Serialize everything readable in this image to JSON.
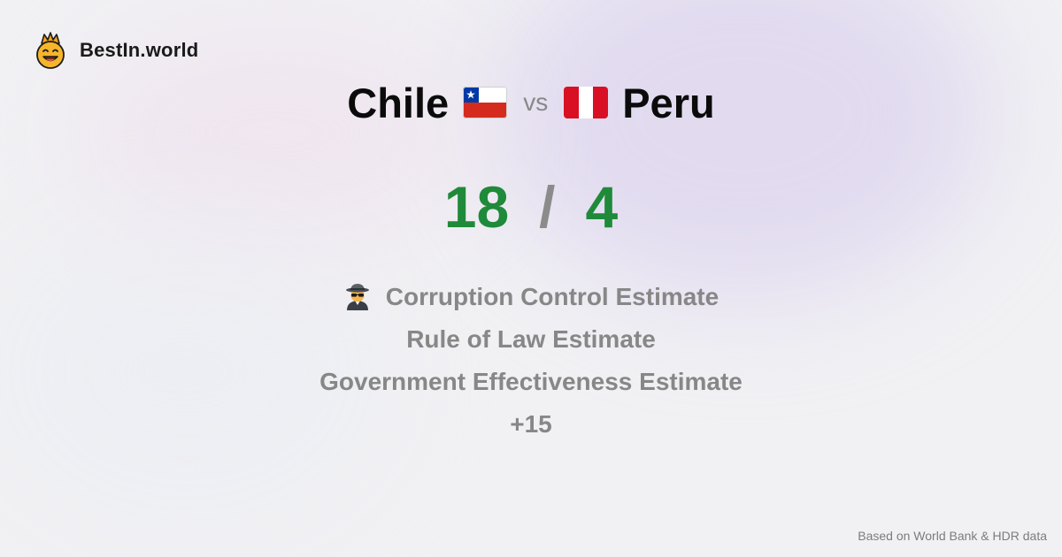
{
  "brand": {
    "name": "BestIn.world",
    "logo_icon": "crowned-smiley-icon"
  },
  "comparison": {
    "left_country": "Chile",
    "left_flag_icon": "chile-flag-icon",
    "separator": "vs",
    "right_country": "Peru",
    "right_flag_icon": "peru-flag-icon"
  },
  "score": {
    "left": "18",
    "divider": "/",
    "right": "4"
  },
  "metrics": [
    {
      "label": "Corruption Control Estimate",
      "icon": "spy-detective-icon"
    },
    {
      "label": "Rule of Law Estimate"
    },
    {
      "label": "Government Effectiveness Estimate"
    },
    {
      "label": "+15"
    }
  ],
  "footer": {
    "source_note": "Based on World Bank & HDR data"
  },
  "colors": {
    "score_green": "#1f8a3a",
    "muted_gray": "#878787",
    "chile_red": "#d52b1e",
    "chile_blue": "#0039a6",
    "peru_red": "#d91023"
  }
}
